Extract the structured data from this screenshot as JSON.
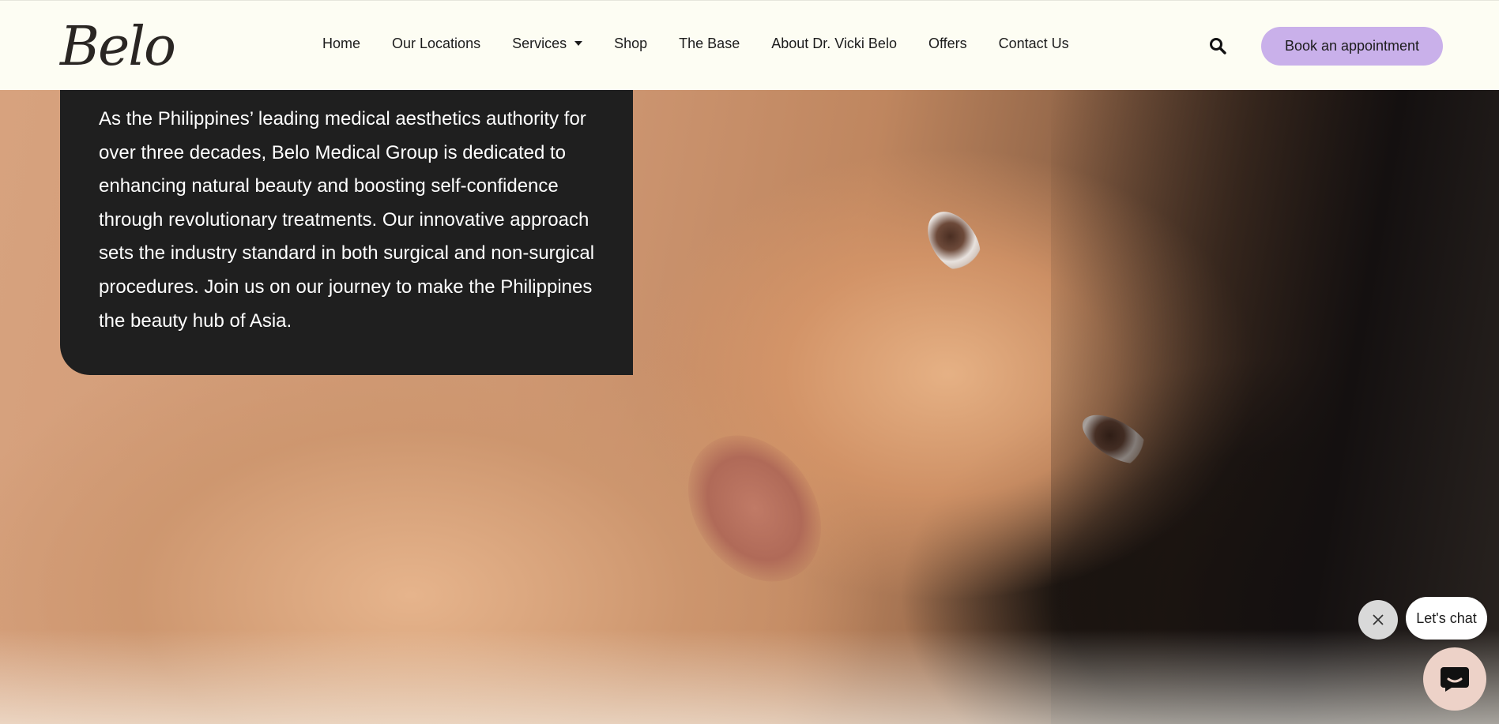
{
  "brand": {
    "logo_text": "Belo"
  },
  "nav": {
    "items": [
      {
        "label": "Home"
      },
      {
        "label": "Our Locations"
      },
      {
        "label": "Services"
      },
      {
        "label": "Shop"
      },
      {
        "label": "The Base"
      },
      {
        "label": "About Dr. Vicki Belo"
      },
      {
        "label": "Offers"
      },
      {
        "label": "Contact Us"
      }
    ],
    "book_label": "Book an appointment"
  },
  "hero": {
    "description": "As the Philippines’ leading medical aesthetics authority for over three decades, Belo Medical Group is dedicated to enhancing natural beauty and boosting self-confidence through revolutionary treatments. Our innovative approach sets the industry standard in both surgical and non-surgical procedures. Join us on our journey to make the Philippines the beauty hub of Asia."
  },
  "chat": {
    "bubble_label": "Let's chat"
  },
  "colors": {
    "accent": "#c9b0ea",
    "card": "#1f1f1f",
    "header_bg": "#fdfdf3",
    "chat_launch": "#edd2c8"
  },
  "icons": {
    "search": "search-icon",
    "close": "close-icon",
    "chat": "chat-icon",
    "caret": "chevron-down-icon"
  }
}
